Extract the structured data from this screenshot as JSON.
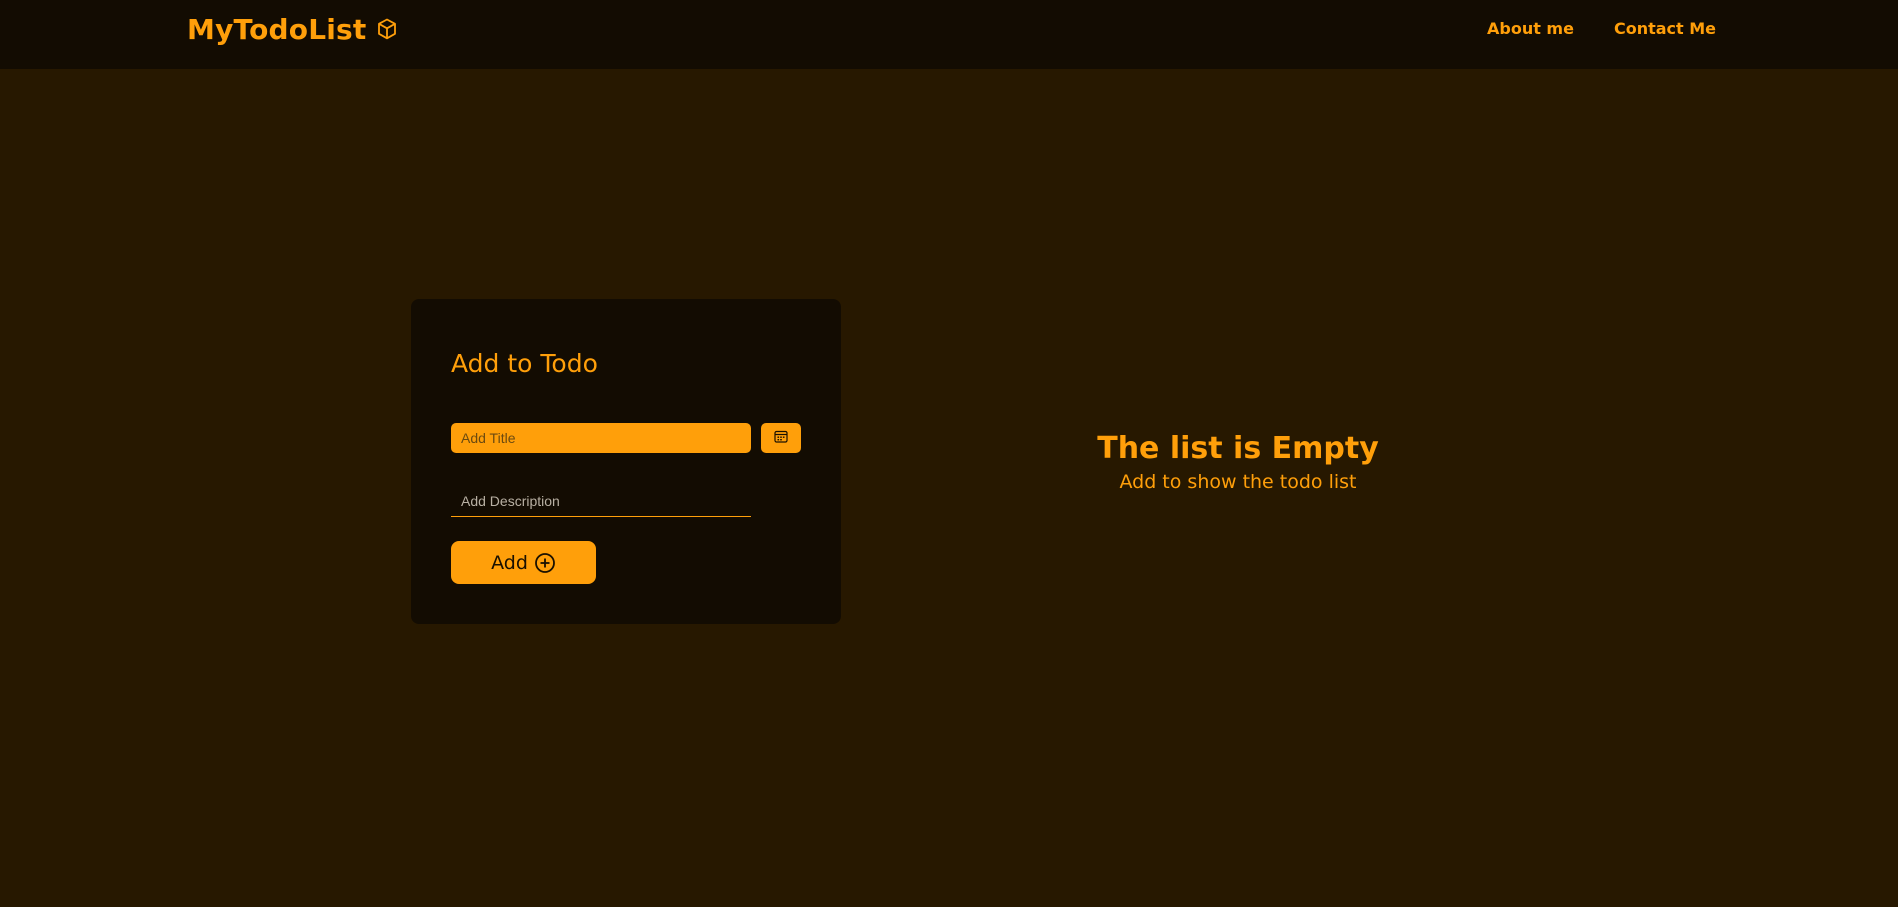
{
  "navbar": {
    "brand": "MyTodoList",
    "brand_icon": "cube-icon",
    "links": [
      {
        "label": "About me"
      },
      {
        "label": "Contact Me"
      }
    ]
  },
  "form": {
    "title": "Add to Todo",
    "title_placeholder": "Add Title",
    "title_value": "",
    "calendar_icon": "calendar-icon",
    "description_placeholder": "Add Description",
    "description_value": "",
    "add_label": "Add",
    "add_icon": "plus-circle-icon"
  },
  "empty_state": {
    "title": "The list is Empty",
    "subtitle": "Add to show the todo list"
  },
  "colors": {
    "accent": "#ff9f0a",
    "background": "#271800",
    "panel": "#130c02"
  }
}
